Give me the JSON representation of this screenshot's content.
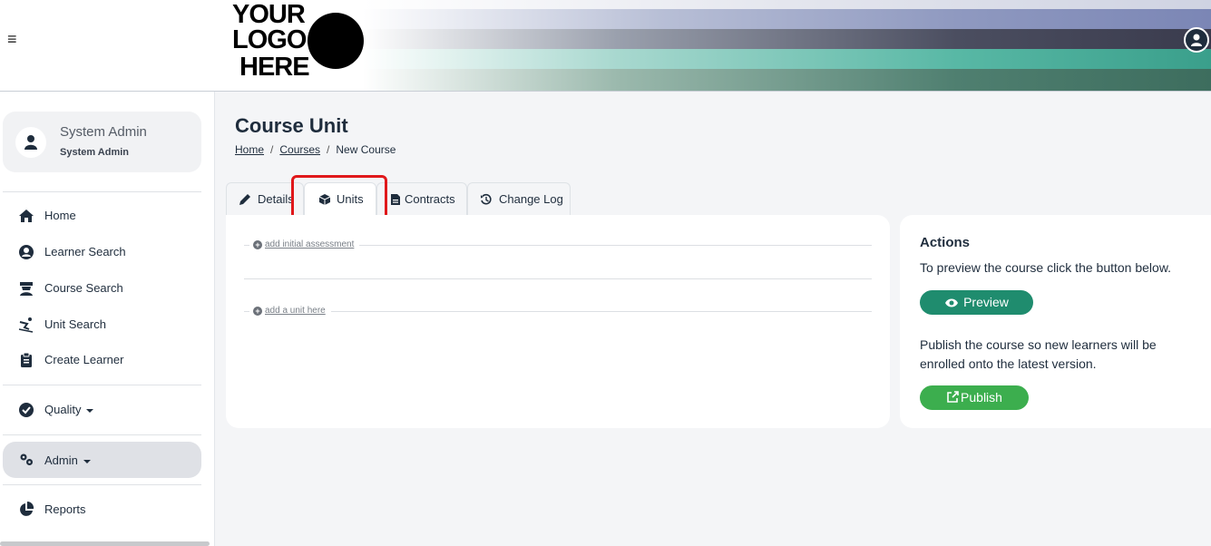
{
  "header": {
    "logo_lines": [
      "YOUR",
      "LOGO",
      "HERE"
    ]
  },
  "sidebar": {
    "profile": {
      "name": "System Admin",
      "role": "System Admin"
    },
    "items": [
      {
        "label": "Home",
        "icon": "home-icon"
      },
      {
        "label": "Learner Search",
        "icon": "user-circle-icon"
      },
      {
        "label": "Course Search",
        "icon": "graduation-icon"
      },
      {
        "label": "Unit Search",
        "icon": "skiing-icon"
      },
      {
        "label": "Create Learner",
        "icon": "clipboard-icon"
      },
      {
        "label": "Quality",
        "icon": "check-circle-icon"
      },
      {
        "label": "Admin",
        "icon": "cogs-icon"
      },
      {
        "label": "Reports",
        "icon": "pie-chart-icon"
      }
    ]
  },
  "main": {
    "title": "Course Unit",
    "breadcrumb": {
      "home": "Home",
      "courses": "Courses",
      "current": "New Course"
    },
    "tabs": [
      {
        "label": "Details",
        "icon": "pencil-icon"
      },
      {
        "label": "Units",
        "icon": "cube-icon"
      },
      {
        "label": "Contracts",
        "icon": "file-icon"
      },
      {
        "label": "Change Log",
        "icon": "history-icon"
      }
    ],
    "units": {
      "add_initial_assessment": "add initial assessment",
      "add_unit": "add a unit here"
    },
    "actions": {
      "title": "Actions",
      "preview_text": "To preview the course click the button below.",
      "preview_label": "Preview",
      "publish_text": "Publish the course so new learners will be enrolled onto the latest version.",
      "publish_label": "Publish"
    }
  },
  "colors": {
    "preview_button": "#1f8c6e",
    "publish_button": "#3cae4e",
    "highlight": "#e0181b"
  }
}
